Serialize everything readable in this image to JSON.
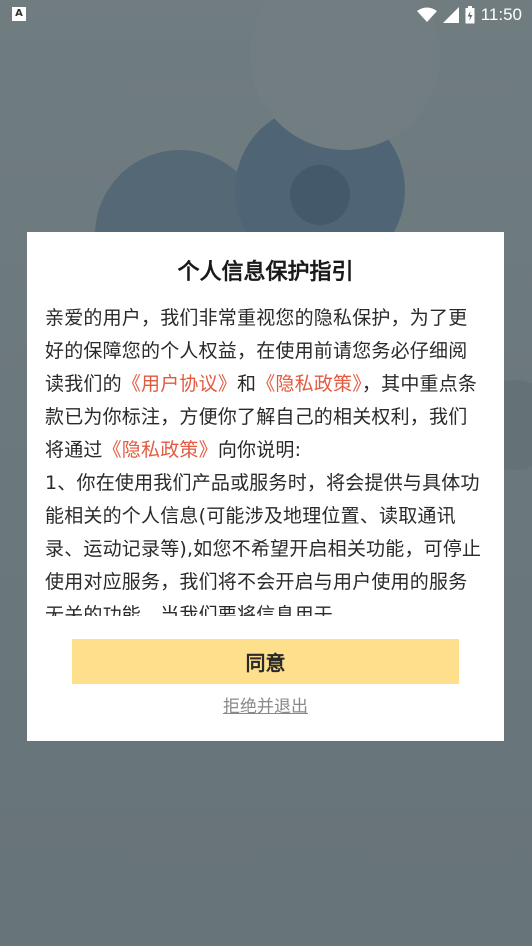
{
  "status_bar": {
    "app_icon": "A",
    "time": "11:50",
    "icons": [
      "wifi-icon",
      "signal-icon",
      "battery-icon"
    ]
  },
  "dialog": {
    "title": "个人信息保护指引",
    "para1_intro": "亲爱的用户，我们非常重视您的隐私保护，为了更好的保障您的个人权益，在使用前请您务必仔细阅读我们的",
    "user_agreement_link": "《用户协议》",
    "and_text": "和",
    "privacy_policy_link": "《隐私政策》",
    "para1_mid": "，其中重点条款已为你标注，方便你了解自己的相关权利，我们将通过",
    "privacy_policy_link_2": "《隐私政策》",
    "para1_end": "向你说明:",
    "para2": "1、你在使用我们产品或服务时，将会提供与具体功能相关的个人信息(可能涉及地理位置、读取通讯录、运动记录等),如您不希望开启相关功能，可停止使用对应服务，我们将不会开启与用户使用的服务无关的功能，当我们要将信息用于",
    "agree_label": "同意",
    "refuse_label": "拒绝并退出"
  },
  "colors": {
    "link": "#e35a40",
    "agree_button": "#fedf8c",
    "overlay": "#5f6e6f"
  }
}
